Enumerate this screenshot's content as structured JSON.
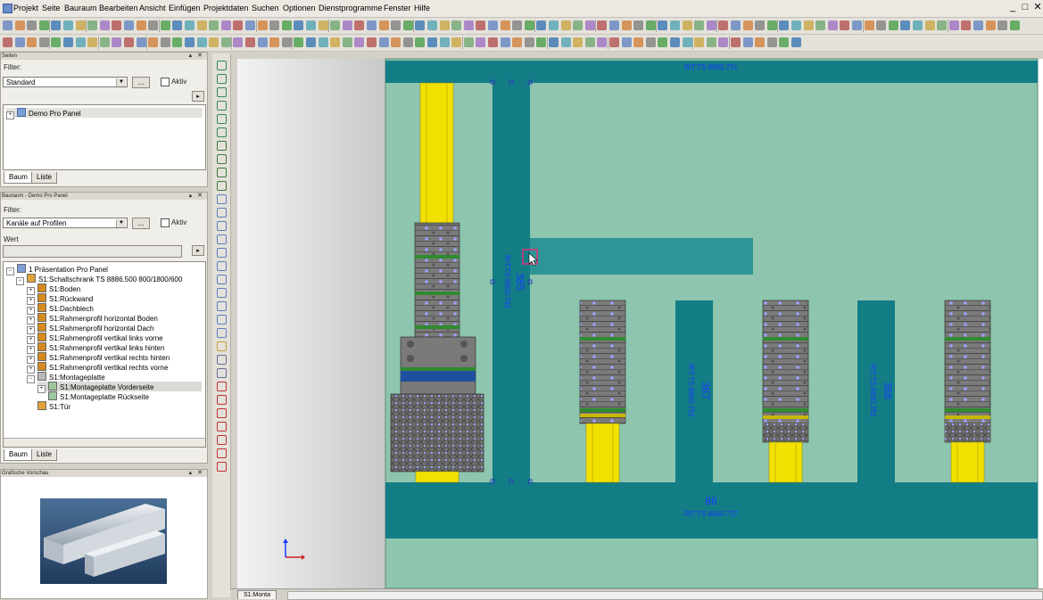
{
  "menu": {
    "items": [
      "Projekt",
      "Seite",
      "Bauraum",
      "Bearbeiten",
      "Ansicht",
      "Einfügen",
      "Projektdaten",
      "Suchen",
      "Optionen",
      "Dienstprogramme",
      "Fenster",
      "Hilfe"
    ],
    "window_buttons": [
      "_",
      "□",
      "✕"
    ]
  },
  "pages_panel": {
    "title": "Seiten",
    "filter_label": "Filter:",
    "filter_value": "Standard",
    "dots_button": "...",
    "active_label": "Aktiv",
    "tree": [
      {
        "label": "Demo Pro Panel"
      }
    ],
    "tabs": [
      "Baum",
      "Liste"
    ]
  },
  "space_panel": {
    "title": "Bauraum - Demo Pro Panel",
    "filter_label": "Filter:",
    "filter_value": "Kanäle auf Profilen",
    "dots_button": "...",
    "active_label": "Aktiv",
    "value_label": "Wert",
    "tree": [
      "1 Präsentation Pro Panel",
      "S1:Schaltschrank TS 8886.500  800/1800/600",
      "S1:Boden",
      "S1:Rückwand",
      "S1:Dachblech",
      "S1:Rahmenprofil horizontal Boden",
      "S1:Rahmenprofil horizontal Dach",
      "S1:Rahmenprofil vertikal links vorne",
      "S1:Rahmenprofil vertikal links hinten",
      "S1:Rahmenprofil vertikal rechts hinten",
      "S1:Rahmenprofil vertikal rechts vorne",
      "S1:Montageplatte",
      "S1:Montageplatte Vorderseite",
      "S1:Montageplatte Rückseite",
      "S1:Tür"
    ],
    "tabs": [
      "Baum",
      "Liste"
    ]
  },
  "preview_panel": {
    "title": "Grafische Vorschau"
  },
  "drawing": {
    "top_rail_label": "RIT.TS 8800.751",
    "bottom_rail_number": "86",
    "bottom_rail_label": "RIT.TS 8800.737",
    "duct_385_number": "385",
    "duct_385_label": "RIT.TS 8800.751",
    "duct_387_number": "387",
    "duct_387_label": "RIT.TS 8800.751",
    "duct_388_number": "388",
    "duct_388_label": "RIT.TS 8800.751"
  },
  "status": {
    "sheet_tab": "S1:Monta"
  },
  "colors": {
    "plate": "#8ec5ae",
    "duct": "#137d86",
    "duct_selected": "#2e9596",
    "rail": "#f2e100",
    "terminal": "#7a7a7a",
    "annotation": "#1a3cff"
  }
}
